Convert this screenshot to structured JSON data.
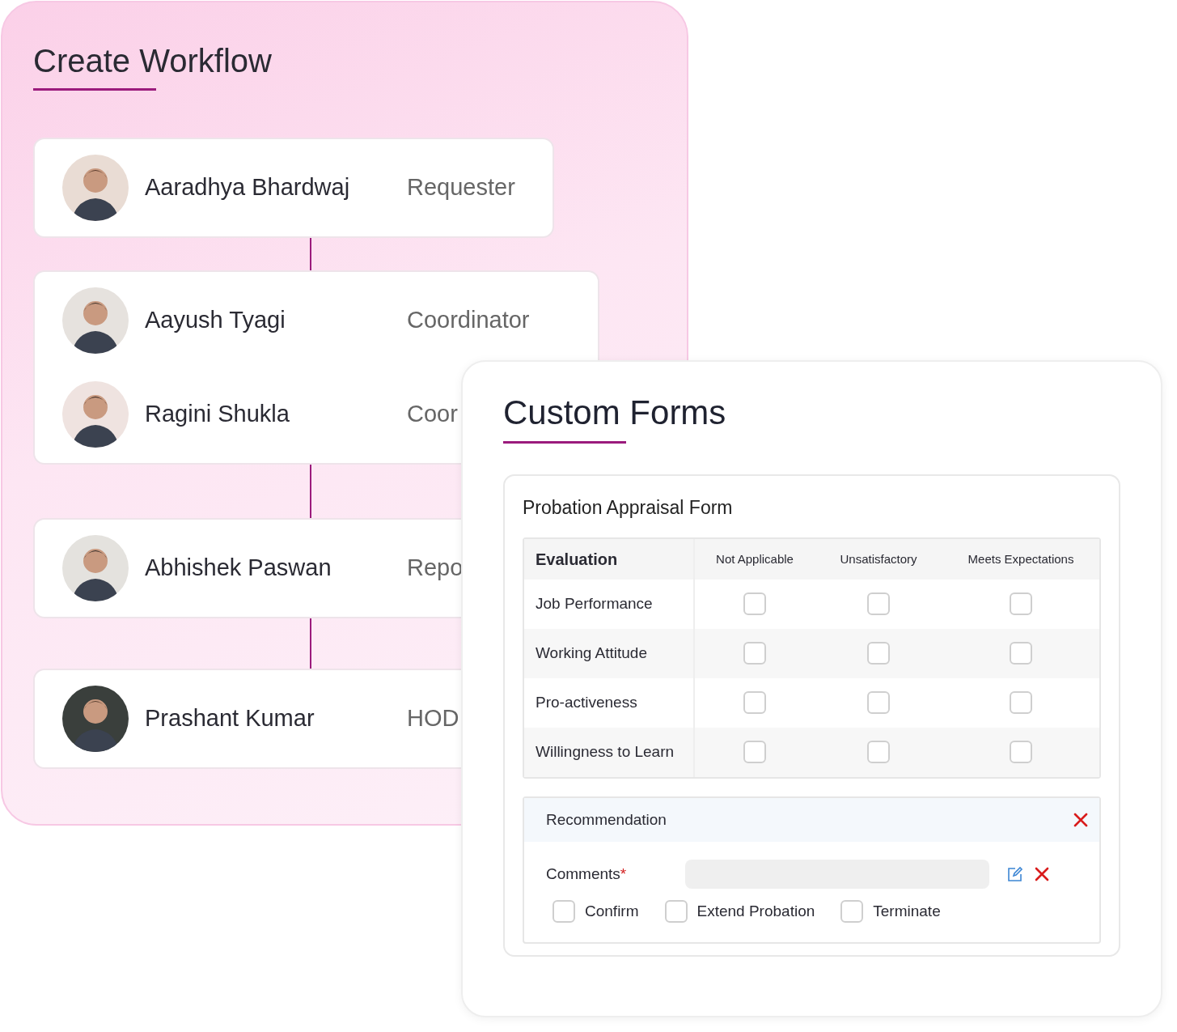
{
  "workflow": {
    "title": "Create Workflow",
    "steps": [
      {
        "people": [
          {
            "name": "Aaradhya Bhardwaj",
            "role": "Requester"
          }
        ]
      },
      {
        "people": [
          {
            "name": "Aayush Tyagi",
            "role": "Coordinator"
          },
          {
            "name": "Ragini Shukla",
            "role": "Coor"
          }
        ]
      },
      {
        "people": [
          {
            "name": "Abhishek Paswan",
            "role": "Repo"
          }
        ]
      },
      {
        "people": [
          {
            "name": "Prashant Kumar",
            "role": "HOD"
          }
        ]
      }
    ]
  },
  "custom_forms": {
    "title": "Custom Forms",
    "form": {
      "title": "Probation Appraisal Form",
      "columns": [
        "Evaluation",
        "Not Applicable",
        "Unsatisfactory",
        "Meets Expectations"
      ],
      "rows": [
        {
          "label": "Job Performance",
          "checks": [
            false,
            false,
            false
          ]
        },
        {
          "label": "Working Attitude",
          "checks": [
            false,
            false,
            false
          ]
        },
        {
          "label": "Pro-activeness",
          "checks": [
            false,
            false,
            false
          ]
        },
        {
          "label": "Willingness to Learn",
          "checks": [
            false,
            false,
            false
          ]
        }
      ]
    },
    "recommendation": {
      "title": "Recommendation",
      "comments_label": "Comments",
      "required_mark": "*",
      "options": [
        {
          "label": "Confirm",
          "checked": false
        },
        {
          "label": "Extend Probation",
          "checked": false
        },
        {
          "label": "Terminate",
          "checked": false
        }
      ]
    }
  }
}
